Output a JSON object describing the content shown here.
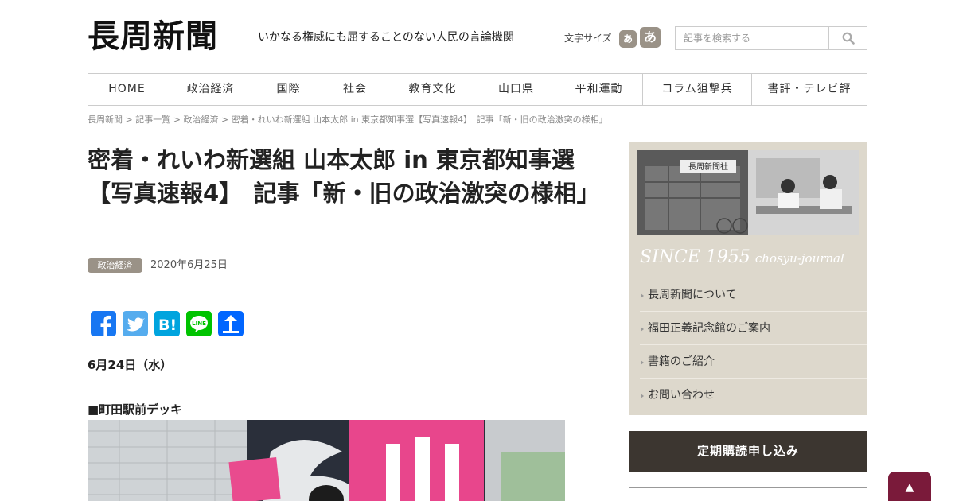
{
  "header": {
    "logo": "長周新聞",
    "tagline": "いかなる権威にも屈することのない人民の言論機関",
    "font_size_label": "文字サイズ",
    "font_size_small": "あ",
    "font_size_large": "あ",
    "search_placeholder": "記事を検索する"
  },
  "nav": {
    "items": [
      {
        "label": "HOME"
      },
      {
        "label": "政治経済"
      },
      {
        "label": "国際"
      },
      {
        "label": "社会"
      },
      {
        "label": "教育文化"
      },
      {
        "label": "山口県"
      },
      {
        "label": "平和運動"
      },
      {
        "label": "コラム狙撃兵"
      },
      {
        "label": "書評・テレビ評"
      }
    ]
  },
  "breadcrumb": "長周新聞 > 記事一覧 > 政治経済 > 密着・れいわ新選組 山本太郎 in 東京都知事選【写真速報4】　記事「新・旧の政治激突の様相」",
  "article": {
    "title": "密着・れいわ新選組 山本太郎 in 東京都知事選【写真速報4】　記事「新・旧の政治激突の様相」",
    "category": "政治経済",
    "date": "2020年6月25日",
    "day_heading": "6月24日（水）",
    "location_heading": "■町田駅前デッキ",
    "share": [
      {
        "icon": "facebook-icon",
        "color": "#1877f2"
      },
      {
        "icon": "twitter-icon",
        "color": "#55acee"
      },
      {
        "icon": "hatena-bookmark-icon",
        "color": "#00a4de"
      },
      {
        "icon": "line-icon",
        "color": "#00c300"
      },
      {
        "icon": "share-icon",
        "color": "#0166ff"
      }
    ]
  },
  "sidebar": {
    "since_text": "SINCE 1955",
    "since_sub": "chosyu-journal",
    "photo_sign": "長周新聞社",
    "links": [
      {
        "label": "長周新聞について"
      },
      {
        "label": "福田正義記念館のご案内"
      },
      {
        "label": "書籍のご紹介"
      },
      {
        "label": "お問い合わせ"
      }
    ],
    "subscribe_label": "定期購読申し込み"
  },
  "back_to_top": "▲",
  "colors": {
    "badge": "#9a9287",
    "sidebar_bg": "#ddd8cc",
    "subscribe_bg": "#3c3630",
    "to_top_bg": "#7a1a3a"
  }
}
